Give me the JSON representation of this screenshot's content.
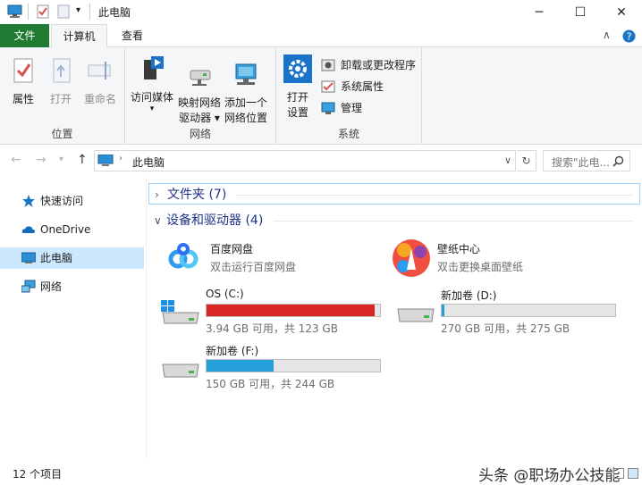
{
  "titlebar": {
    "title": "此电脑",
    "minimize_glyph": "─",
    "maximize_glyph": "☐",
    "close_glyph": "✕"
  },
  "tabs": {
    "file": "文件",
    "computer": "计算机",
    "view": "查看"
  },
  "ribbon": {
    "location": {
      "label": "位置",
      "properties": "属性",
      "open": "打开",
      "rename": "重命名"
    },
    "network": {
      "label": "网络",
      "access_media": "访问媒体",
      "map_drive_line1": "映射网络",
      "map_drive_line2": "驱动器 ▾",
      "add_location_line1": "添加一个",
      "add_location_line2": "网络位置"
    },
    "system": {
      "label": "系统",
      "open_settings_line1": "打开",
      "open_settings_line2": "设置",
      "uninstall": "卸载或更改程序",
      "system_properties": "系统属性",
      "manage": "管理"
    }
  },
  "address": {
    "path": "此电脑",
    "search_placeholder": "搜索\"此电...",
    "back_glyph": "←",
    "forward_glyph": "→",
    "dropdown_glyph": "∨",
    "up_glyph": "↑",
    "refresh_glyph": "↻"
  },
  "nav": {
    "items": [
      {
        "label": "快速访问"
      },
      {
        "label": "OneDrive"
      },
      {
        "label": "此电脑"
      },
      {
        "label": "网络"
      }
    ]
  },
  "content": {
    "folders_header": "文件夹 (7)",
    "devices_header": "设备和驱动器 (4)",
    "apps": [
      {
        "name": "百度网盘",
        "desc": "双击运行百度网盘"
      },
      {
        "name": "壁纸中心",
        "desc": "双击更换桌面壁纸"
      }
    ],
    "drives": [
      {
        "name": "OS (C:)",
        "free": "3.94 GB 可用，共 123 GB",
        "used_fraction": 0.968,
        "bar_color": "#da2626"
      },
      {
        "name": "新加卷 (D:)",
        "free": "270 GB 可用，共 275 GB",
        "used_fraction": 0.018,
        "bar_color": "#26a0da"
      },
      {
        "name": "新加卷 (F:)",
        "free": "150 GB 可用，共 244 GB",
        "used_fraction": 0.385,
        "bar_color": "#26a0da"
      }
    ]
  },
  "status": {
    "count": "12 个项目",
    "watermark": "头条 @职场办公技能"
  },
  "colors": {
    "file_tab": "#1f7a32",
    "selection": "#cce8ff",
    "group_header_text": "#1e3287"
  }
}
